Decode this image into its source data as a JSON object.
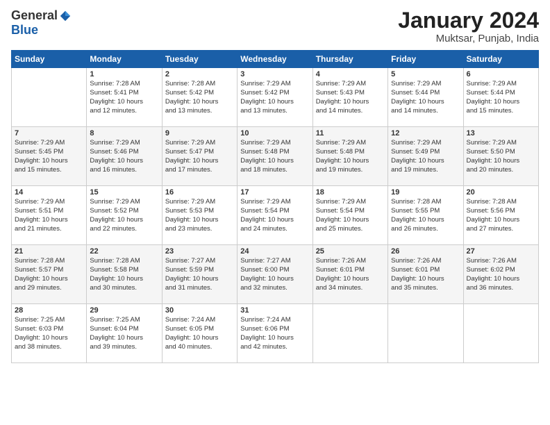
{
  "header": {
    "logo_general": "General",
    "logo_blue": "Blue",
    "title": "January 2024",
    "subtitle": "Muktsar, Punjab, India"
  },
  "weekdays": [
    "Sunday",
    "Monday",
    "Tuesday",
    "Wednesday",
    "Thursday",
    "Friday",
    "Saturday"
  ],
  "weeks": [
    [
      {
        "day": "",
        "info": ""
      },
      {
        "day": "1",
        "info": "Sunrise: 7:28 AM\nSunset: 5:41 PM\nDaylight: 10 hours\nand 12 minutes."
      },
      {
        "day": "2",
        "info": "Sunrise: 7:28 AM\nSunset: 5:42 PM\nDaylight: 10 hours\nand 13 minutes."
      },
      {
        "day": "3",
        "info": "Sunrise: 7:29 AM\nSunset: 5:42 PM\nDaylight: 10 hours\nand 13 minutes."
      },
      {
        "day": "4",
        "info": "Sunrise: 7:29 AM\nSunset: 5:43 PM\nDaylight: 10 hours\nand 14 minutes."
      },
      {
        "day": "5",
        "info": "Sunrise: 7:29 AM\nSunset: 5:44 PM\nDaylight: 10 hours\nand 14 minutes."
      },
      {
        "day": "6",
        "info": "Sunrise: 7:29 AM\nSunset: 5:44 PM\nDaylight: 10 hours\nand 15 minutes."
      }
    ],
    [
      {
        "day": "7",
        "info": "Sunrise: 7:29 AM\nSunset: 5:45 PM\nDaylight: 10 hours\nand 15 minutes."
      },
      {
        "day": "8",
        "info": "Sunrise: 7:29 AM\nSunset: 5:46 PM\nDaylight: 10 hours\nand 16 minutes."
      },
      {
        "day": "9",
        "info": "Sunrise: 7:29 AM\nSunset: 5:47 PM\nDaylight: 10 hours\nand 17 minutes."
      },
      {
        "day": "10",
        "info": "Sunrise: 7:29 AM\nSunset: 5:48 PM\nDaylight: 10 hours\nand 18 minutes."
      },
      {
        "day": "11",
        "info": "Sunrise: 7:29 AM\nSunset: 5:48 PM\nDaylight: 10 hours\nand 19 minutes."
      },
      {
        "day": "12",
        "info": "Sunrise: 7:29 AM\nSunset: 5:49 PM\nDaylight: 10 hours\nand 19 minutes."
      },
      {
        "day": "13",
        "info": "Sunrise: 7:29 AM\nSunset: 5:50 PM\nDaylight: 10 hours\nand 20 minutes."
      }
    ],
    [
      {
        "day": "14",
        "info": "Sunrise: 7:29 AM\nSunset: 5:51 PM\nDaylight: 10 hours\nand 21 minutes."
      },
      {
        "day": "15",
        "info": "Sunrise: 7:29 AM\nSunset: 5:52 PM\nDaylight: 10 hours\nand 22 minutes."
      },
      {
        "day": "16",
        "info": "Sunrise: 7:29 AM\nSunset: 5:53 PM\nDaylight: 10 hours\nand 23 minutes."
      },
      {
        "day": "17",
        "info": "Sunrise: 7:29 AM\nSunset: 5:54 PM\nDaylight: 10 hours\nand 24 minutes."
      },
      {
        "day": "18",
        "info": "Sunrise: 7:29 AM\nSunset: 5:54 PM\nDaylight: 10 hours\nand 25 minutes."
      },
      {
        "day": "19",
        "info": "Sunrise: 7:28 AM\nSunset: 5:55 PM\nDaylight: 10 hours\nand 26 minutes."
      },
      {
        "day": "20",
        "info": "Sunrise: 7:28 AM\nSunset: 5:56 PM\nDaylight: 10 hours\nand 27 minutes."
      }
    ],
    [
      {
        "day": "21",
        "info": "Sunrise: 7:28 AM\nSunset: 5:57 PM\nDaylight: 10 hours\nand 29 minutes."
      },
      {
        "day": "22",
        "info": "Sunrise: 7:28 AM\nSunset: 5:58 PM\nDaylight: 10 hours\nand 30 minutes."
      },
      {
        "day": "23",
        "info": "Sunrise: 7:27 AM\nSunset: 5:59 PM\nDaylight: 10 hours\nand 31 minutes."
      },
      {
        "day": "24",
        "info": "Sunrise: 7:27 AM\nSunset: 6:00 PM\nDaylight: 10 hours\nand 32 minutes."
      },
      {
        "day": "25",
        "info": "Sunrise: 7:26 AM\nSunset: 6:01 PM\nDaylight: 10 hours\nand 34 minutes."
      },
      {
        "day": "26",
        "info": "Sunrise: 7:26 AM\nSunset: 6:01 PM\nDaylight: 10 hours\nand 35 minutes."
      },
      {
        "day": "27",
        "info": "Sunrise: 7:26 AM\nSunset: 6:02 PM\nDaylight: 10 hours\nand 36 minutes."
      }
    ],
    [
      {
        "day": "28",
        "info": "Sunrise: 7:25 AM\nSunset: 6:03 PM\nDaylight: 10 hours\nand 38 minutes."
      },
      {
        "day": "29",
        "info": "Sunrise: 7:25 AM\nSunset: 6:04 PM\nDaylight: 10 hours\nand 39 minutes."
      },
      {
        "day": "30",
        "info": "Sunrise: 7:24 AM\nSunset: 6:05 PM\nDaylight: 10 hours\nand 40 minutes."
      },
      {
        "day": "31",
        "info": "Sunrise: 7:24 AM\nSunset: 6:06 PM\nDaylight: 10 hours\nand 42 minutes."
      },
      {
        "day": "",
        "info": ""
      },
      {
        "day": "",
        "info": ""
      },
      {
        "day": "",
        "info": ""
      }
    ]
  ]
}
